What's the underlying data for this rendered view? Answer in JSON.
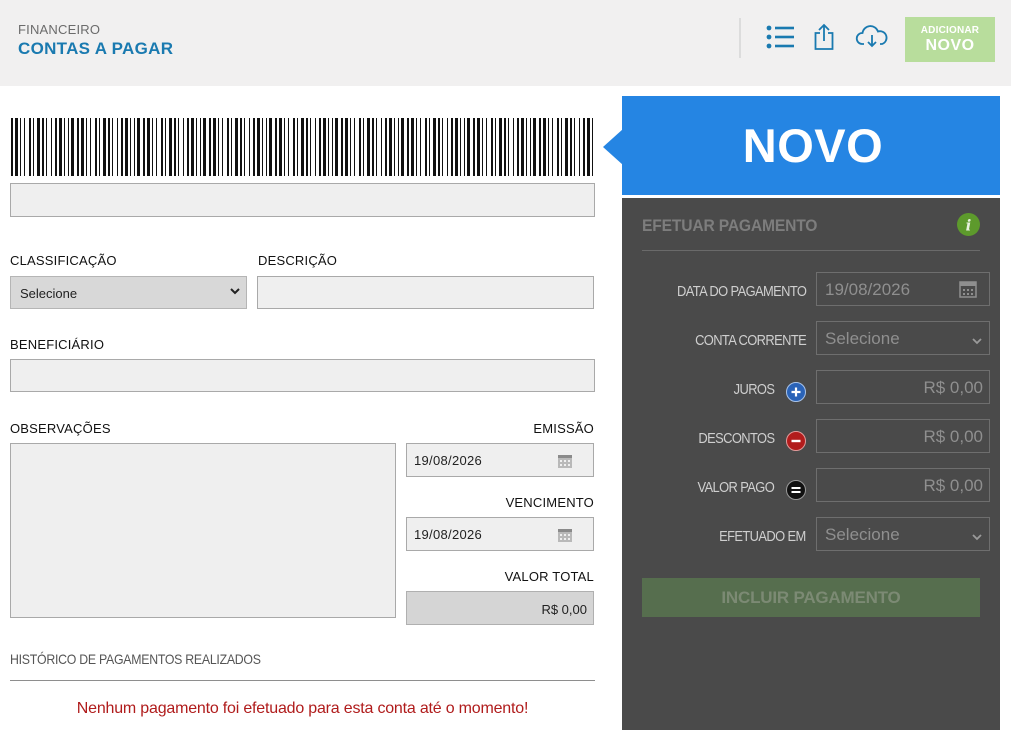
{
  "header": {
    "breadcrumb": "FINANCEIRO",
    "title": "CONTAS A PAGAR",
    "icons": [
      "list-icon",
      "share-icon",
      "cloud-download-icon"
    ],
    "add_button_small": "ADICIONAR",
    "add_button_big": "NOVO"
  },
  "form": {
    "barcode_value": "",
    "classificacao_label": "CLASSIFICAÇÃO",
    "classificacao_value": "Selecione",
    "descricao_label": "DESCRIÇÃO",
    "descricao_value": "",
    "beneficiario_label": "BENEFICIÁRIO",
    "beneficiario_value": "",
    "observacoes_label": "OBSERVAÇÕES",
    "observacoes_value": "",
    "emissao_label": "EMISSÃO",
    "emissao_value": "19/08/2026",
    "vencimento_label": "VENCIMENTO",
    "vencimento_value": "19/08/2026",
    "valor_total_label": "VALOR TOTAL",
    "valor_total_value": "R$ 0,00"
  },
  "history": {
    "title": "HISTÓRICO DE PAGAMENTOS REALIZADOS",
    "empty_message": "Nenhum pagamento foi efetuado para esta conta até o momento!"
  },
  "status_banner": "NOVO",
  "payment_panel": {
    "title": "EFETUAR PAGAMENTO",
    "data_pagamento_label": "DATA DO PAGAMENTO",
    "data_pagamento_value": "19/08/2026",
    "conta_corrente_label": "CONTA CORRENTE",
    "conta_corrente_value": "Selecione",
    "juros_label": "JUROS",
    "juros_value": "R$ 0,00",
    "descontos_label": "DESCONTOS",
    "descontos_value": "R$ 0,00",
    "valor_pago_label": "VALOR PAGO",
    "valor_pago_value": "R$ 0,00",
    "efetuado_em_label": "EFETUADO EM",
    "efetuado_em_value": "Selecione",
    "submit_label": "INCLUIR PAGAMENTO"
  },
  "colors": {
    "accent_blue": "#2585e3",
    "title_blue": "#1a7ab0",
    "add_green": "#b8dd9c",
    "panel_dark": "#4a4a4a",
    "error_red": "#b01c1c"
  }
}
